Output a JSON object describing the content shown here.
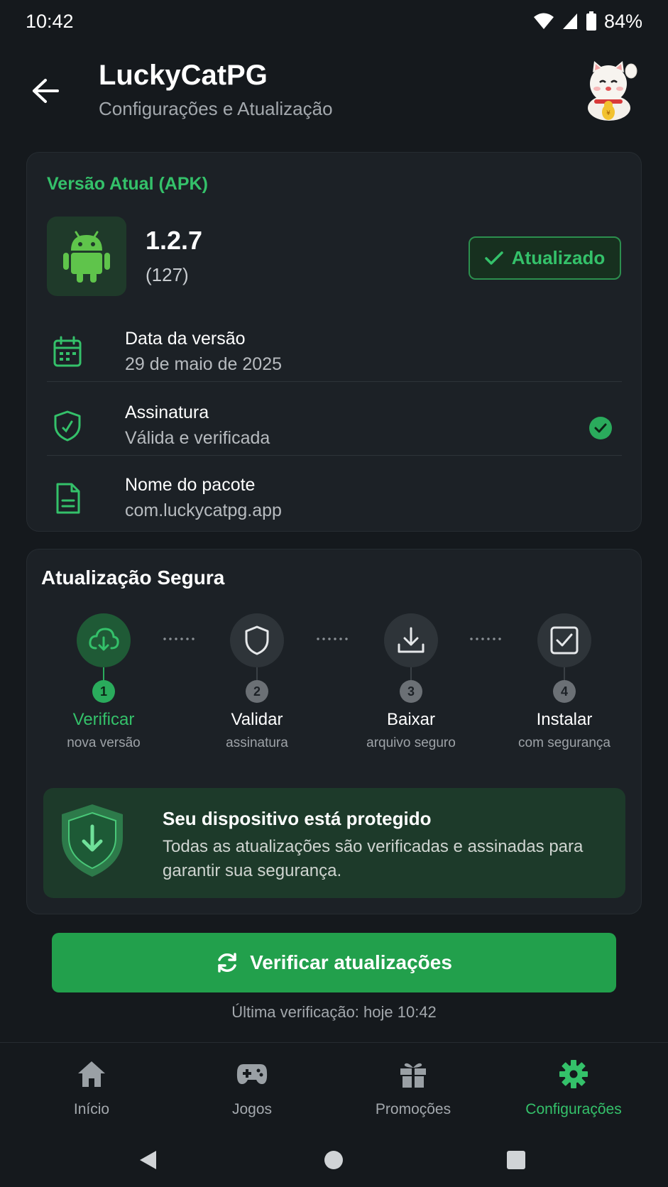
{
  "status_bar": {
    "time": "10:42",
    "battery": "84%"
  },
  "header": {
    "title": "LuckyCatPG",
    "subtitle": "Configurações e Atualização"
  },
  "version_card": {
    "section_label": "Versão Atual (APK)",
    "version": "1.2.7",
    "build": "(127)",
    "badge": "Atualizado",
    "rows": [
      {
        "label": "Data da versão",
        "value": "29 de maio de 2025",
        "icon": "calendar-icon"
      },
      {
        "label": "Assinatura",
        "value": "Válida e verificada",
        "icon": "shield-check-icon"
      },
      {
        "label": "Nome do pacote",
        "value": "com.luckycatpg.app",
        "icon": "document-icon"
      }
    ]
  },
  "secure_update": {
    "title": "Atualização Segura",
    "steps": [
      {
        "num": "1",
        "name": "Verificar",
        "desc": "nova versão",
        "icon": "cloud-download-icon",
        "active": true
      },
      {
        "num": "2",
        "name": "Validar",
        "desc": "assinatura",
        "icon": "shield-icon",
        "active": false
      },
      {
        "num": "3",
        "name": "Baixar",
        "desc": "arquivo seguro",
        "icon": "download-icon",
        "active": false
      },
      {
        "num": "4",
        "name": "Instalar",
        "desc": "com segurança",
        "icon": "checkbox-icon",
        "active": false
      }
    ],
    "protect_title": "Seu dispositivo está protegido",
    "protect_text": "Todas as atualizações são verificadas e assinadas para garantir sua segurança."
  },
  "cta": {
    "label": "Verificar atualizações"
  },
  "last_check": "Última verificação: hoje 10:42",
  "bottom_nav": [
    {
      "label": "Início",
      "icon": "home-icon",
      "active": false
    },
    {
      "label": "Jogos",
      "icon": "gamepad-icon",
      "active": false
    },
    {
      "label": "Promoções",
      "icon": "gift-icon",
      "active": false
    },
    {
      "label": "Configurações",
      "icon": "gear-icon",
      "active": true
    }
  ],
  "colors": {
    "accent": "#34c16a",
    "button": "#22a04c",
    "background": "#15191d",
    "card": "#1c2126"
  }
}
